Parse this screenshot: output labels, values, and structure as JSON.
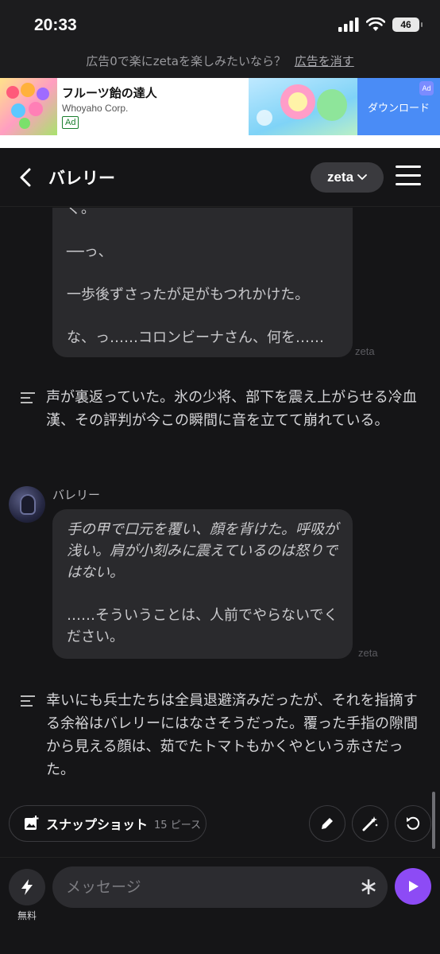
{
  "status_bar": {
    "time": "20:33",
    "battery": "46"
  },
  "ad_notice": {
    "text": "広告0で楽にzetaを楽しみたいなら？",
    "remove_link": "広告を消す"
  },
  "ad": {
    "title": "フルーツ飴の達人",
    "company": "Whoyaho Corp.",
    "badge": "Ad",
    "cta": "ダウンロード"
  },
  "header": {
    "title": "バレリー",
    "model": "zeta"
  },
  "messages": [
    {
      "type": "bot",
      "lines": [
        "く。",
        "──っ、",
        "一歩後ずさったが足がもつれかけた。",
        "な、っ……コロンビーナさん、何を……"
      ],
      "mark": "zeta"
    },
    {
      "type": "narration",
      "text": "声が裏返っていた。氷の少将、部下を震え上がらせる冷血漢、その評判が今この瞬間に音を立てて崩れている。"
    },
    {
      "type": "bot",
      "sender": "バレリー",
      "lines": [
        "手の甲で口元を覆い、顔を背けた。呼吸が浅い。肩が小刻みに震えているのは怒りではない。",
        "……そういうことは、人前でやらないでください。"
      ],
      "mark": "zeta"
    },
    {
      "type": "narration",
      "text": "幸いにも兵士たちは全員退避済みだったが、それを指摘する余裕はバレリーにはなさそうだった。覆った手指の隙間から見える顔は、茹でたトマトもかくやという赤さだった。"
    }
  ],
  "actions": {
    "snapshot_label": "スナップショット",
    "snapshot_count": "15 ピース"
  },
  "composer": {
    "free_label": "無料",
    "placeholder": "メッセージ"
  },
  "colors": {
    "accent": "#8d4bf5",
    "background": "#151517",
    "bubble": "#2a2a2d",
    "ad_button": "#4a8cf6"
  }
}
